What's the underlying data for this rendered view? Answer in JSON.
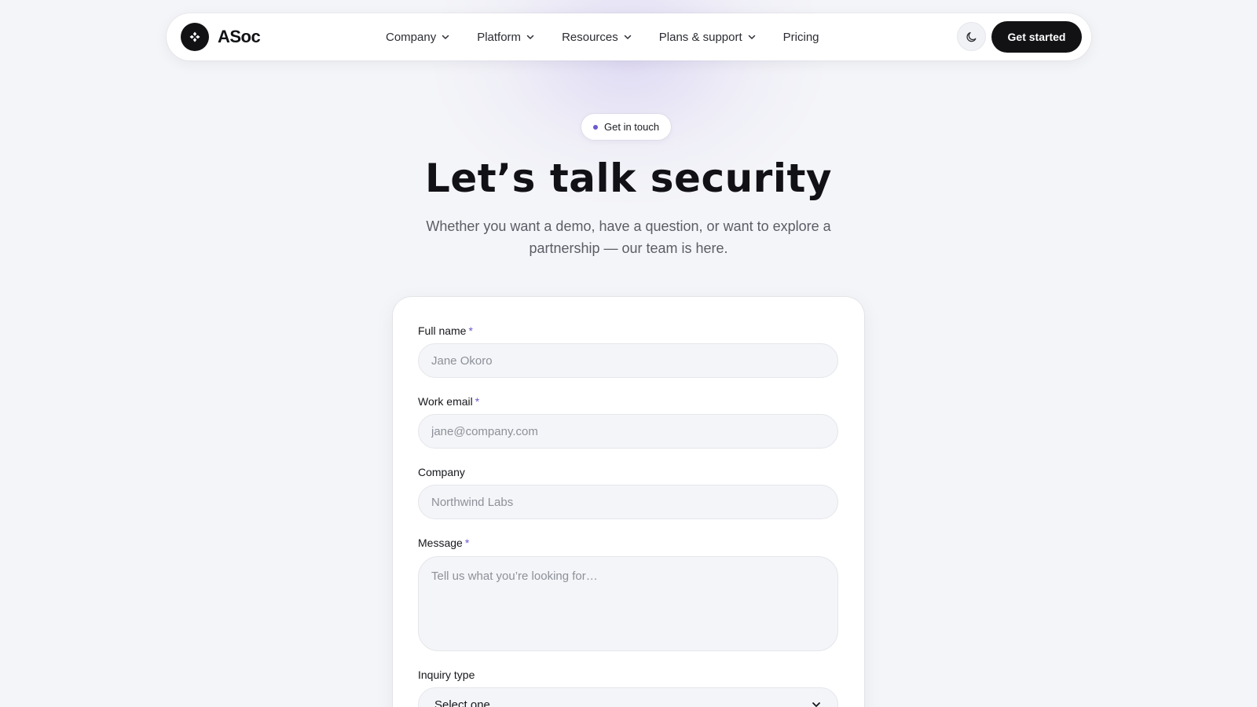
{
  "header": {
    "brand": "ASoc",
    "nav": [
      {
        "label": "Company",
        "icon": "chevron-down-icon"
      },
      {
        "label": "Platform",
        "icon": "chevron-down-icon"
      },
      {
        "label": "Resources",
        "icon": "chevron-down-icon"
      },
      {
        "label": "Plans & support",
        "icon": "chevron-down-icon"
      },
      {
        "label": "Pricing"
      }
    ],
    "theme_toggle_icon": "moon-icon",
    "cta_label": "Get started"
  },
  "hero": {
    "badge": "Get in touch",
    "title": "Let’s talk security",
    "subtitle": "Whether you want a demo, have a question, or want to explore a partnership — our team is here."
  },
  "form": {
    "full_name": {
      "label": "Full name",
      "required": "*",
      "placeholder": "Jane Okoro"
    },
    "work_email": {
      "label": "Work email",
      "required": "*",
      "placeholder": "jane@company.com"
    },
    "company": {
      "label": "Company",
      "placeholder": "Northwind Labs"
    },
    "message": {
      "label": "Message",
      "required": "*",
      "placeholder": "Tell us what you’re looking for…"
    },
    "inquiry_type": {
      "label": "Inquiry type",
      "selected": "Select one"
    }
  },
  "colors": {
    "accent": "#6a5acd",
    "primary_button": "#121215",
    "background": "#f4f5f8"
  }
}
